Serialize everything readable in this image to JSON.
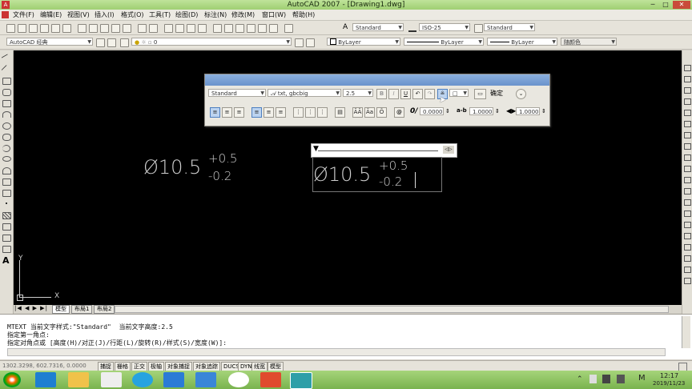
{
  "window": {
    "title": "AutoCAD 2007 - [Drawing1.dwg]"
  },
  "menu": [
    "文件(F)",
    "编辑(E)",
    "视图(V)",
    "插入(I)",
    "格式(O)",
    "工具(T)",
    "绘图(D)",
    "标注(N)",
    "修改(M)",
    "窗口(W)",
    "帮助(H)"
  ],
  "toolbar": {
    "text_style": "Standard",
    "dim_style": "ISO-25",
    "table_style": "Standard",
    "workspace": "AutoCAD 经典",
    "layer": "0",
    "color": "ByLayer",
    "linetype": "ByLayer",
    "lineweight": "ByLayer",
    "plotstyle": "随颜色"
  },
  "text_format": {
    "style": "Standard",
    "font": "txt, gbcbig",
    "height": "2.5",
    "ok_label": "确定",
    "oblique": "0.0000",
    "tracking": "1.0000",
    "width_factor": "1.0000",
    "symbol_label": "@"
  },
  "drawing": {
    "dim1_base": "Ø10.5",
    "dim1_upper": "+0.5",
    "dim1_lower": "-0.2",
    "dim2_base": "Ø10.5",
    "dim2_upper": "+0.5",
    "dim2_lower": "-0.2",
    "ucs_x": "X",
    "ucs_y": "Y"
  },
  "tabs": [
    "模型",
    "布局1",
    "布局2"
  ],
  "command": {
    "line1": "MTEXT 当前文字样式:\"Standard\"  当前文字高度:2.5",
    "line2": "指定第一角点:",
    "line3": "指定对角点或 [高度(H)/对正(J)/行距(L)/旋转(R)/样式(S)/宽度(W)]:"
  },
  "status": {
    "coords": "1302.3298, 602.7316, 0.0000",
    "buttons": [
      "捕捉",
      "栅格",
      "正交",
      "极轴",
      "对象捕捉",
      "对象追踪",
      "DUCS",
      "DYN",
      "线宽",
      "模型"
    ]
  },
  "tray": {
    "time": "12:17",
    "date": "2019/11/23"
  }
}
